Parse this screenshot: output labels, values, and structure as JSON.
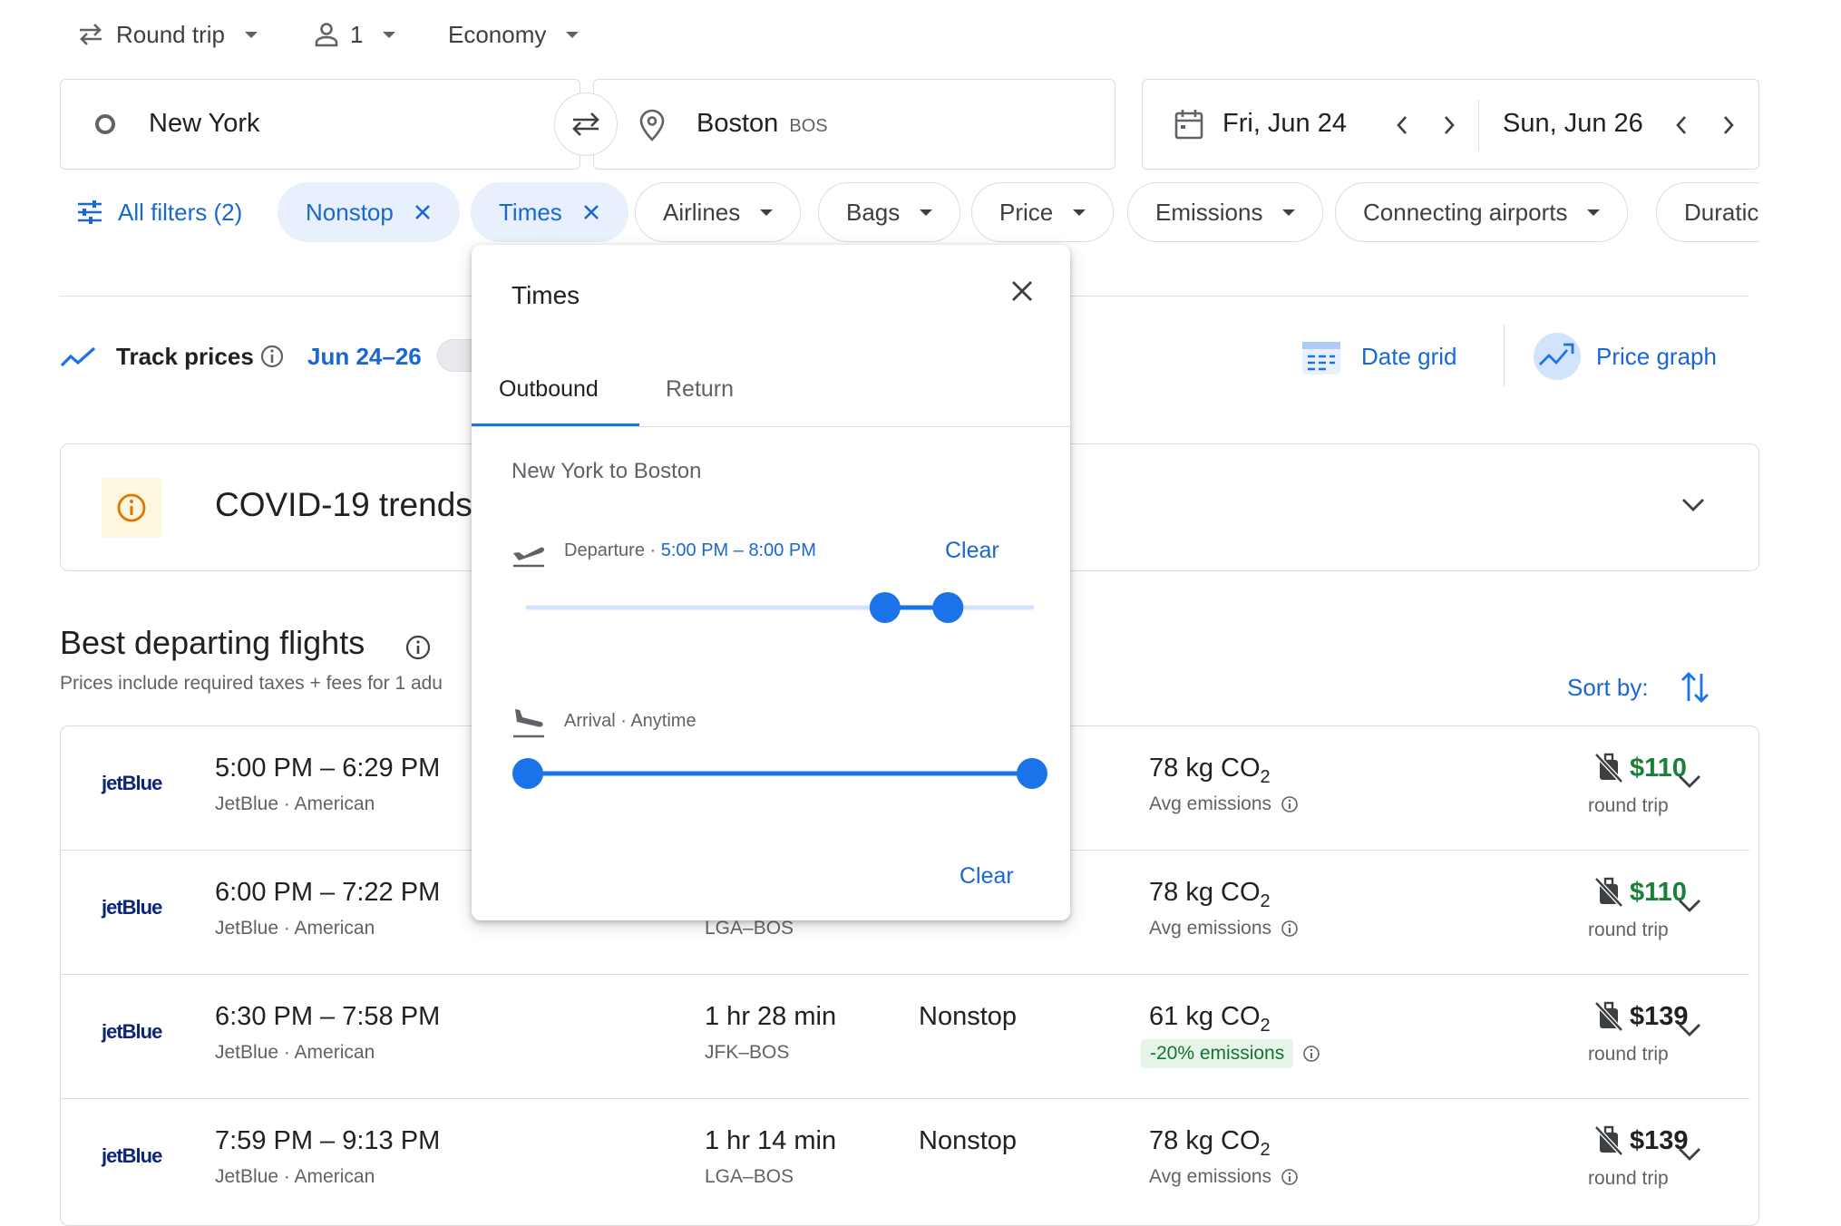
{
  "top": {
    "trip_type": "Round trip",
    "passengers": "1",
    "cabin": "Economy"
  },
  "search": {
    "origin": "New York",
    "destination": "Boston",
    "destination_code": "BOS",
    "depart_date": "Fri, Jun 24",
    "return_date": "Sun, Jun 26"
  },
  "filters": {
    "all_filters": "All filters (2)",
    "nonstop": "Nonstop",
    "times": "Times",
    "airlines": "Airlines",
    "bags": "Bags",
    "price": "Price",
    "emissions": "Emissions",
    "connecting": "Connecting airports",
    "duration": "Duratic"
  },
  "track": {
    "label": "Track prices",
    "dates": "Jun 24–26"
  },
  "tools": {
    "date_grid": "Date grid",
    "price_graph": "Price graph"
  },
  "covid": {
    "title": "COVID-19 trends"
  },
  "results": {
    "heading": "Best departing flights",
    "subtitle": "Prices include required taxes + fees for 1 adu",
    "sort_label": "Sort by:"
  },
  "flights": [
    {
      "logo": "jetBlue",
      "time": "5:00 PM – 6:29 PM",
      "airlines": "JetBlue · American",
      "duration": "",
      "route": "",
      "stops": "",
      "co2": "78 kg CO",
      "co2_sub": "2",
      "emissions": "Avg emissions",
      "price": "$110",
      "price_green": true,
      "price_note": "round trip"
    },
    {
      "logo": "jetBlue",
      "time": "6:00 PM – 7:22 PM",
      "airlines": "JetBlue · American",
      "duration": "",
      "route": "LGA–BOS",
      "stops": "",
      "co2": "78 kg CO",
      "co2_sub": "2",
      "emissions": "Avg emissions",
      "price": "$110",
      "price_green": true,
      "price_note": "round trip"
    },
    {
      "logo": "jetBlue",
      "time": "6:30 PM – 7:58 PM",
      "airlines": "JetBlue · American",
      "duration": "1 hr 28 min",
      "route": "JFK–BOS",
      "stops": "Nonstop",
      "co2": "61 kg CO",
      "co2_sub": "2",
      "emissions": "-20% emissions",
      "price": "$139",
      "price_green": false,
      "price_note": "round trip"
    },
    {
      "logo": "jetBlue",
      "time": "7:59 PM – 9:13 PM",
      "airlines": "JetBlue · American",
      "duration": "1 hr 14 min",
      "route": "LGA–BOS",
      "stops": "Nonstop",
      "co2": "78 kg CO",
      "co2_sub": "2",
      "emissions": "Avg emissions",
      "price": "$139",
      "price_green": false,
      "price_note": "round trip"
    }
  ],
  "popup": {
    "title": "Times",
    "tab_outbound": "Outbound",
    "tab_return": "Return",
    "route_label": "New York to Boston",
    "departure_label": "Departure",
    "departure_range": "5:00 PM – 8:00 PM",
    "arrival_label": "Arrival",
    "arrival_range": "Anytime",
    "clear_label": "Clear",
    "clear_all_label": "Clear",
    "departure_slider": {
      "min_hour": 17,
      "max_hour": 20
    },
    "arrival_slider": {
      "min_hour": 0,
      "max_hour": 24
    }
  },
  "colors": {
    "accent": "#1a73e8",
    "chip_selected_bg": "#e8f0fe",
    "price_green": "#188038",
    "emission_good_bg": "#e6f4ea"
  }
}
